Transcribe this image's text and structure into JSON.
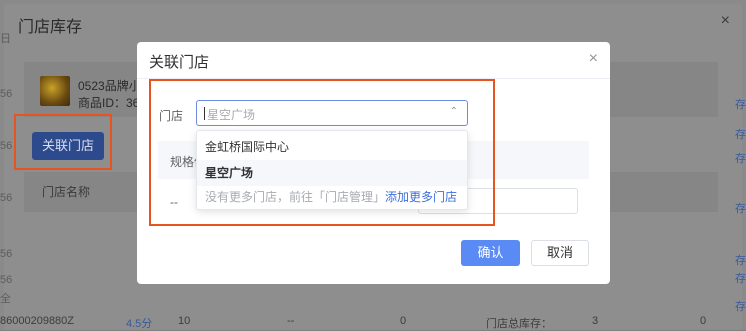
{
  "background": {
    "dialog_title": "门店库存",
    "close_icon": "×",
    "product": {
      "name": "0523品牌小",
      "id": "商品ID：36"
    },
    "associate_button": "关联门店",
    "store_name_col": "门店名称",
    "left_edge_texts": [
      "日",
      "56",
      "56",
      "56",
      "56",
      "56",
      "全"
    ],
    "right_edge_links": [
      "存",
      "存",
      "存",
      "存",
      "存",
      "存",
      "存"
    ],
    "bottom_row": {
      "code": "86000209880Z",
      "rate": "4.5分",
      "qty": "10",
      "dash": "--",
      "zero1": "0",
      "total_label": "门店总库存：",
      "total_val": "3",
      "zero2": "0"
    }
  },
  "modal": {
    "title": "关联门店",
    "close_icon": "×",
    "field_label": "门店",
    "select": {
      "placeholder": "星空广场",
      "arrow_icon": "chevron-up-icon"
    },
    "table": {
      "spec_header": "规格值",
      "row_dash": "--"
    },
    "dropdown": {
      "options": [
        {
          "label": "金虹桥国际中心",
          "selected": false
        },
        {
          "label": "星空广场",
          "selected": true
        }
      ],
      "footer_text": "没有更多门店，前往「门店管理」",
      "footer_link": "添加更多门店"
    },
    "confirm_button": "确认",
    "cancel_button": "取消"
  },
  "colors": {
    "highlight": "#e8541f",
    "primary": "#5a8bf4",
    "link": "#3d6fdf"
  }
}
